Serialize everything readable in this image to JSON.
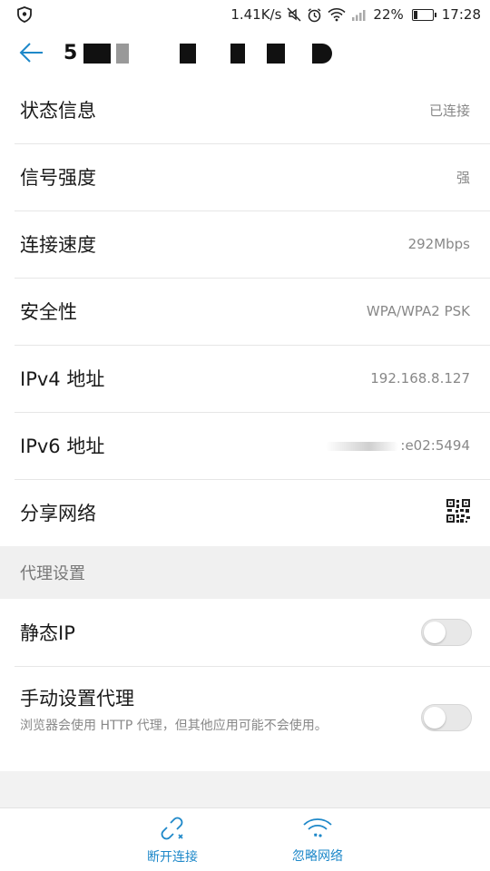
{
  "status_bar": {
    "net_speed": "1.41K/s",
    "battery_percent": "22%",
    "battery_level": 0.22,
    "time": "17:28",
    "icons": [
      "shield-icon",
      "mute-icon",
      "alarm-icon",
      "wifi-icon",
      "signal-icon",
      "battery-icon"
    ]
  },
  "app_bar": {
    "title_visible": "5",
    "title_suffix": "的家园"
  },
  "info_rows": [
    {
      "label": "状态信息",
      "value": "已连接"
    },
    {
      "label": "信号强度",
      "value": "强"
    },
    {
      "label": "连接速度",
      "value": "292Mbps"
    },
    {
      "label": "安全性",
      "value": "WPA/WPA2 PSK"
    },
    {
      "label": "IPv4 地址",
      "value": "192.168.8.127"
    },
    {
      "label": "IPv6 地址",
      "value": ":e02:5494"
    },
    {
      "label": "分享网络",
      "value": ""
    }
  ],
  "proxy_section": {
    "header": "代理设置",
    "static_ip": {
      "label": "静态IP",
      "enabled": false
    },
    "manual_proxy": {
      "label": "手动设置代理",
      "description": "浏览器会使用 HTTP 代理，但其他应用可能不会使用。",
      "enabled": false
    }
  },
  "bottom_bar": {
    "disconnect_label": "断开连接",
    "forget_label": "忽略网络"
  },
  "colors": {
    "accent": "#1e88c9",
    "text": "#1a1a1a",
    "secondary": "#888888"
  }
}
